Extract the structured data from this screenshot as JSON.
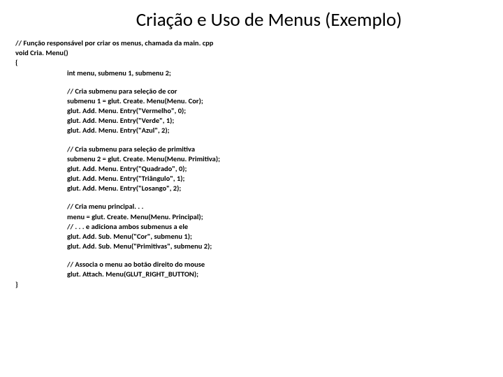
{
  "title": "Criação e Uso de Menus (Exemplo)",
  "code": {
    "l1": "// Função responsável por criar os menus, chamada da main. cpp",
    "l2": "void Cria. Menu()",
    "l3": "{",
    "l4": "int menu, submenu 1, submenu 2;",
    "l5": "// Cria submenu para seleção de cor",
    "l6": "submenu 1 = glut. Create. Menu(Menu. Cor);",
    "l7": "glut. Add. Menu. Entry(\"Vermelho\", 0);",
    "l8": "glut. Add. Menu. Entry(\"Verde\", 1);",
    "l9": "glut. Add. Menu. Entry(\"Azul\", 2);",
    "l10": "// Cria submenu para seleção de primitiva",
    "l11": "submenu 2 = glut. Create. Menu(Menu. Primitiva);",
    "l12": "glut. Add. Menu. Entry(\"Quadrado\", 0);",
    "l13": "glut. Add. Menu. Entry(\"Triângulo\", 1);",
    "l14": "glut. Add. Menu. Entry(\"Losango\", 2);",
    "l15": "// Cria menu principal. . .",
    "l16": "menu = glut. Create. Menu(Menu. Principal);",
    "l17": "// . . . e adiciona ambos submenus a ele",
    "l18": "glut. Add. Sub. Menu(\"Cor\", submenu 1);",
    "l19": "glut. Add. Sub. Menu(\"Primitivas\", submenu 2);",
    "l20": "// Associa o menu ao botão direito do mouse",
    "l21": "glut. Attach. Menu(GLUT_RIGHT_BUTTON);",
    "l22": "}"
  }
}
